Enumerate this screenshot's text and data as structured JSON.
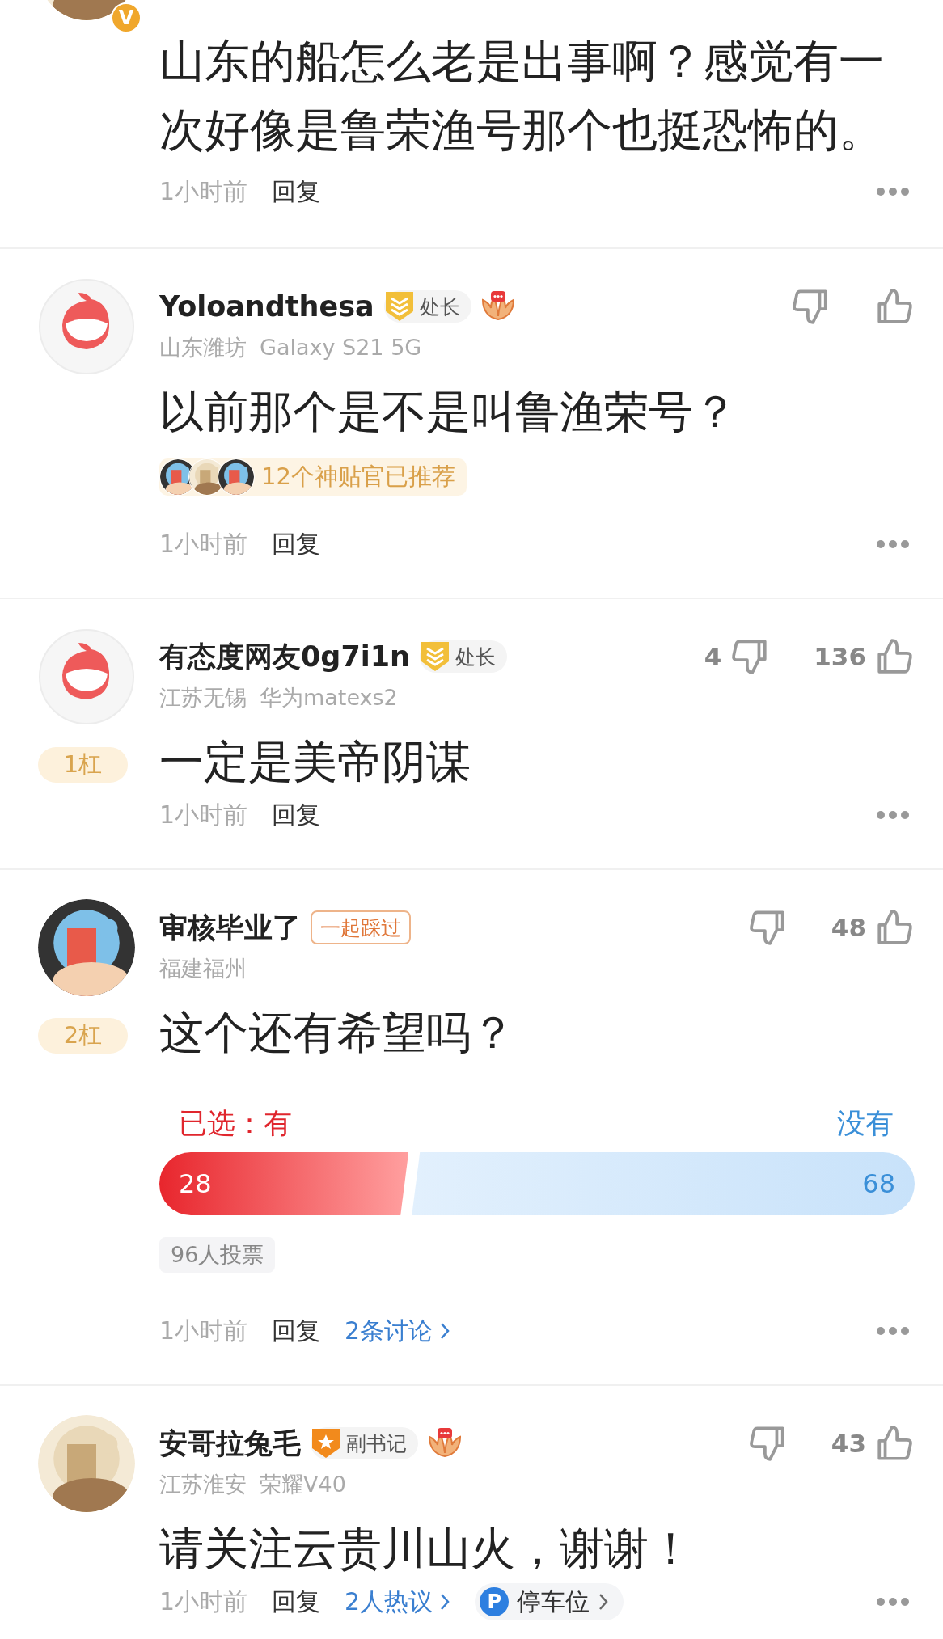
{
  "comments": [
    {
      "kind": "partial",
      "avatar": {
        "kind": "picture"
      },
      "avatar_badge": "V",
      "body": "山东的船怎么老是出事啊？感觉有一次好像是鲁荣渔号那个也挺恐怖的。",
      "time": "1小时前",
      "reply": "回复"
    },
    {
      "kind": "full",
      "avatar": {
        "kind": "logo"
      },
      "user": "Yoloandthesa",
      "title": {
        "kind": "shield",
        "text": "处长"
      },
      "medal": true,
      "location": "山东潍坊",
      "device": "Galaxy S21 5G",
      "body": "以前那个是不是叫鲁渔荣号？",
      "recommend": "12个神贴官已推荐",
      "time": "1小时前",
      "reply": "回复"
    },
    {
      "kind": "full",
      "avatar": {
        "kind": "logo"
      },
      "user": "有态度网友0g7i1n",
      "title": {
        "kind": "shield",
        "text": "处长"
      },
      "medal": false,
      "location": "江苏无锡",
      "device": "华为matexs2",
      "rank": "1杠",
      "dislikes": "4",
      "likes": "136",
      "body": "一定是美帝阴谋",
      "time": "1小时前",
      "reply": "回复"
    },
    {
      "kind": "full",
      "avatar": {
        "kind": "picture"
      },
      "user": "审核毕业了",
      "title": {
        "kind": "outline",
        "text": "一起踩过"
      },
      "medal": false,
      "location": "福建福州",
      "rank": "2杠",
      "likes": "48",
      "body": "这个还有希望吗？",
      "poll": {
        "level": 0.33,
        "options": [
          {
            "label": "已选：有",
            "count": "28",
            "selected": true
          },
          {
            "label": "没有",
            "count": "68",
            "selected": false
          }
        ],
        "votes": "96人投票"
      },
      "time": "1小时前",
      "reply": "回复",
      "links": [
        {
          "kind": "link",
          "text": "2条讨论"
        }
      ]
    },
    {
      "kind": "full",
      "avatar": {
        "kind": "picture"
      },
      "user": "安哥拉兔毛",
      "title": {
        "kind": "star",
        "text": "副书记"
      },
      "medal": true,
      "location": "江苏淮安",
      "device": "荣耀V40",
      "likes": "43",
      "body": "请关注云贵川山火，谢谢！",
      "time": "1小时前",
      "reply": "回复",
      "links": [
        {
          "kind": "link",
          "text": "2人热议"
        },
        {
          "kind": "pill",
          "icon": "P",
          "text": "停车位"
        }
      ]
    }
  ]
}
